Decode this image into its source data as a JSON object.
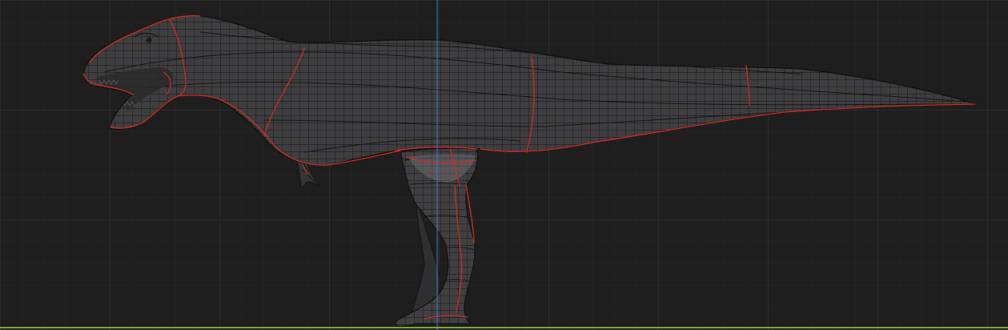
{
  "viewport": {
    "view": "orthographic-side",
    "background_color": "#1e1e1e",
    "grid_minor_color": "#262626",
    "grid_major_color": "#3a3a3a",
    "vertical_axis_color": "#4a7ab8",
    "ground_axis_color": "#7ea63a"
  },
  "model": {
    "subject": "tyrannosaurus-wireframe-mesh",
    "mesh_fill_color": "#3e3e40",
    "wire_color": "#141414",
    "seam_color": "#d3291f"
  }
}
